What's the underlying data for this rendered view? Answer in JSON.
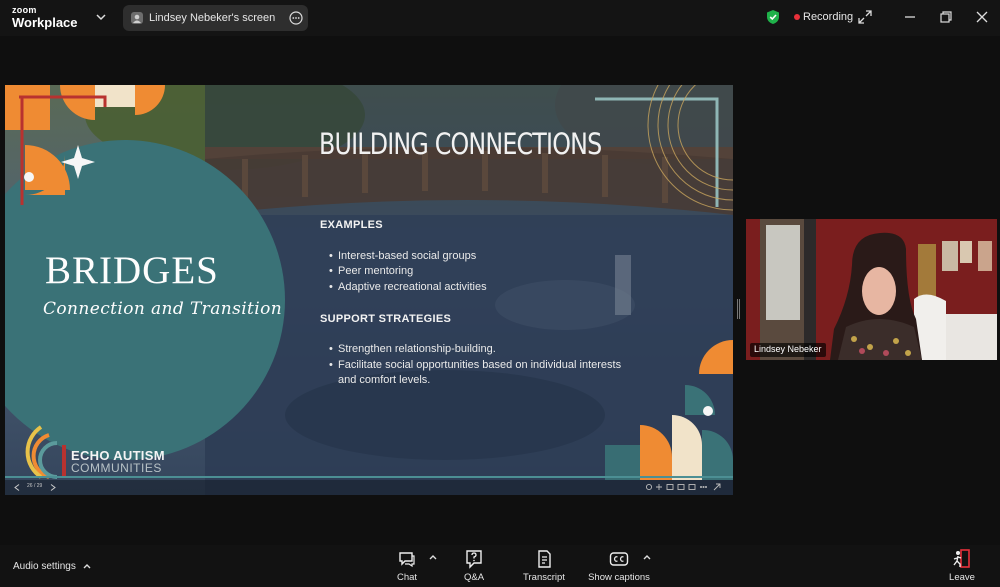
{
  "app": {
    "logo_line1": "zoom",
    "logo_line2": "Workplace"
  },
  "share": {
    "label": "Lindsey Nebeker's screen"
  },
  "status": {
    "recording_label": "Recording",
    "recording_color": "#e8303a",
    "shield_color": "#1fb24a"
  },
  "slide": {
    "title": "BUILDING CONNECTIONS",
    "section1_heading": "EXAMPLES",
    "section1_items": [
      "Interest-based social groups",
      "Peer mentoring",
      "Adaptive recreational activities"
    ],
    "section2_heading": "SUPPORT STRATEGIES",
    "section2_items": [
      "Strengthen relationship-building.",
      "Facilitate social opportunities based on individual interests and comfort levels."
    ],
    "bridges_title": "BRIDGES",
    "bridges_subtitle": "Connection and Transition",
    "org_line1": "ECHO AUTISM",
    "org_line2": "COMMUNITIES",
    "page_indicator": "26 / 29",
    "accent_teal": "#3a7277",
    "accent_orange": "#ef8b33"
  },
  "speaker": {
    "name": "Lindsey Nebeker"
  },
  "toolbar": {
    "audio_settings": "Audio settings",
    "chat": "Chat",
    "qa": "Q&A",
    "transcript": "Transcript",
    "captions": "Show captions",
    "leave": "Leave"
  }
}
